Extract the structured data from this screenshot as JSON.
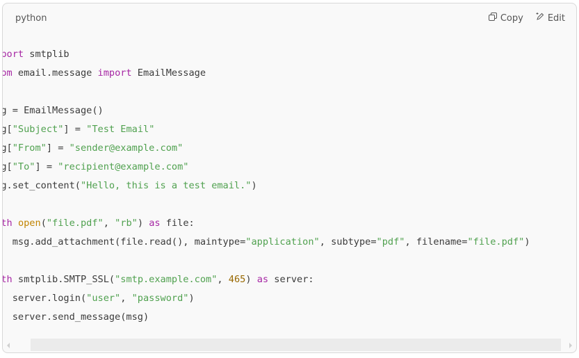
{
  "code_block": {
    "language": "python",
    "copy_label": "Copy",
    "edit_label": "Edit",
    "lines": [
      [
        {
          "t": "import",
          "c": "kw"
        },
        {
          "t": " smtplib",
          "c": ""
        }
      ],
      [
        {
          "t": "from",
          "c": "kw"
        },
        {
          "t": " email.message ",
          "c": ""
        },
        {
          "t": "import",
          "c": "kw"
        },
        {
          "t": " EmailMessage",
          "c": ""
        }
      ],
      [],
      [
        {
          "t": "msg = EmailMessage()",
          "c": ""
        }
      ],
      [
        {
          "t": "msg[",
          "c": ""
        },
        {
          "t": "\"Subject\"",
          "c": "str"
        },
        {
          "t": "] = ",
          "c": ""
        },
        {
          "t": "\"Test Email\"",
          "c": "str"
        }
      ],
      [
        {
          "t": "msg[",
          "c": ""
        },
        {
          "t": "\"From\"",
          "c": "str"
        },
        {
          "t": "] = ",
          "c": ""
        },
        {
          "t": "\"sender@example.com\"",
          "c": "str"
        }
      ],
      [
        {
          "t": "msg[",
          "c": ""
        },
        {
          "t": "\"To\"",
          "c": "str"
        },
        {
          "t": "] = ",
          "c": ""
        },
        {
          "t": "\"recipient@example.com\"",
          "c": "str"
        }
      ],
      [
        {
          "t": "msg.set_content(",
          "c": ""
        },
        {
          "t": "\"Hello, this is a test email.\"",
          "c": "str"
        },
        {
          "t": ")",
          "c": ""
        }
      ],
      [],
      [
        {
          "t": "with",
          "c": "kw"
        },
        {
          "t": " ",
          "c": ""
        },
        {
          "t": "open",
          "c": "bi"
        },
        {
          "t": "(",
          "c": ""
        },
        {
          "t": "\"file.pdf\"",
          "c": "str"
        },
        {
          "t": ", ",
          "c": ""
        },
        {
          "t": "\"rb\"",
          "c": "str"
        },
        {
          "t": ") ",
          "c": ""
        },
        {
          "t": "as",
          "c": "kw"
        },
        {
          "t": " file:",
          "c": ""
        }
      ],
      [
        {
          "t": "    msg.add_attachment(file.read(), maintype=",
          "c": ""
        },
        {
          "t": "\"application\"",
          "c": "str"
        },
        {
          "t": ", subtype=",
          "c": ""
        },
        {
          "t": "\"pdf\"",
          "c": "str"
        },
        {
          "t": ", filename=",
          "c": ""
        },
        {
          "t": "\"file.pdf\"",
          "c": "str"
        },
        {
          "t": ")",
          "c": ""
        }
      ],
      [],
      [
        {
          "t": "with",
          "c": "kw"
        },
        {
          "t": " smtplib.SMTP_SSL(",
          "c": ""
        },
        {
          "t": "\"smtp.example.com\"",
          "c": "str"
        },
        {
          "t": ", ",
          "c": ""
        },
        {
          "t": "465",
          "c": "num"
        },
        {
          "t": ") ",
          "c": ""
        },
        {
          "t": "as",
          "c": "kw"
        },
        {
          "t": " server:",
          "c": ""
        }
      ],
      [
        {
          "t": "    server.login(",
          "c": ""
        },
        {
          "t": "\"user\"",
          "c": "str"
        },
        {
          "t": ", ",
          "c": ""
        },
        {
          "t": "\"password\"",
          "c": "str"
        },
        {
          "t": ")",
          "c": ""
        }
      ],
      [
        {
          "t": "    server.send_message(msg)",
          "c": ""
        }
      ]
    ]
  }
}
